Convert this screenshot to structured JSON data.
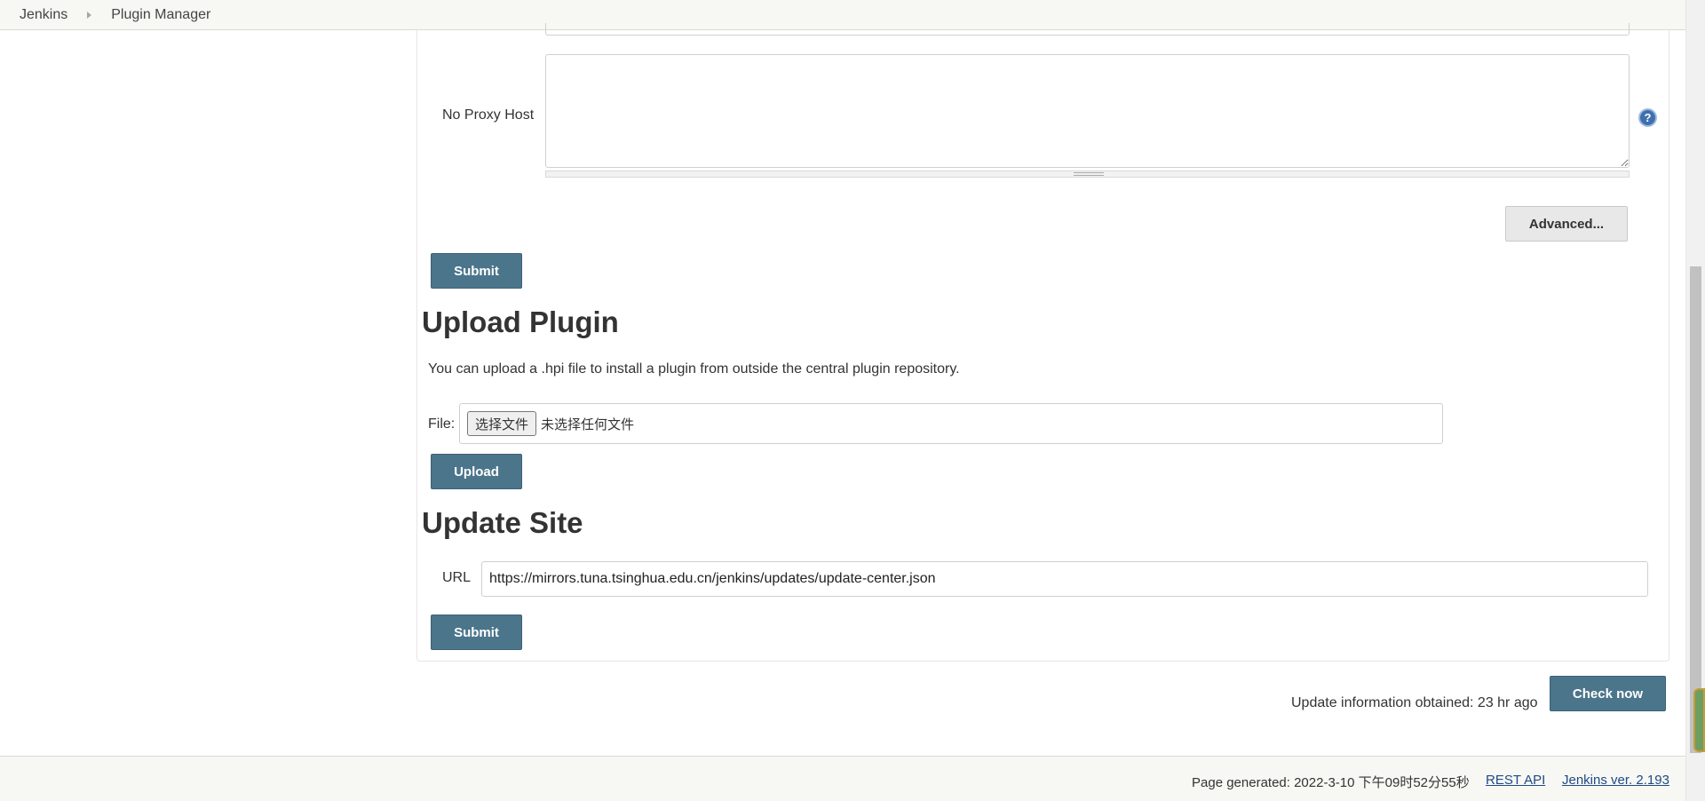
{
  "breadcrumb": {
    "items": [
      "Jenkins",
      "Plugin Manager"
    ]
  },
  "proxy": {
    "no_proxy_label": "No Proxy Host",
    "no_proxy_value": "",
    "help_glyph": "?",
    "advanced_label": "Advanced...",
    "submit_label": "Submit"
  },
  "upload": {
    "title": "Upload Plugin",
    "description": "You can upload a .hpi file to install a plugin from outside the central plugin repository.",
    "file_label": "File:",
    "choose_button": "选择文件",
    "file_status": "未选择任何文件",
    "upload_label": "Upload"
  },
  "update_site": {
    "title": "Update Site",
    "url_label": "URL",
    "url_value": "https://mirrors.tuna.tsinghua.edu.cn/jenkins/updates/update-center.json",
    "submit_label": "Submit"
  },
  "update_info": {
    "text": "Update information obtained: 23 hr ago",
    "check_now_label": "Check now"
  },
  "footer": {
    "generated": "Page generated: 2022-3-10 下午09时52分55秒",
    "rest_api": "REST API",
    "jenkins_version": "Jenkins ver. 2.193"
  },
  "colors": {
    "primary_button": "#4b758b",
    "link": "#204a87",
    "help_icon": "#3f6fb0"
  },
  "icons": [
    "breadcrumb-separator-icon",
    "help-icon"
  ]
}
